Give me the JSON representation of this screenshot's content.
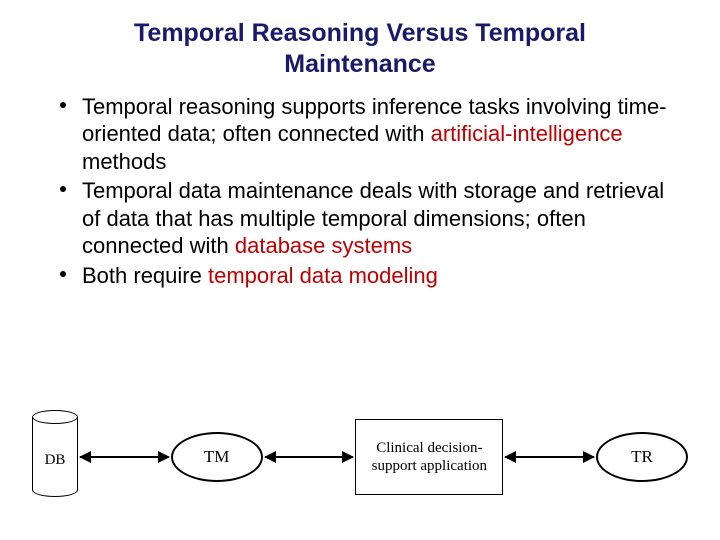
{
  "title": "Temporal Reasoning Versus Temporal Maintenance",
  "bullets": [
    {
      "pre": "Temporal reasoning supports inference tasks involving time-oriented data; often connected with ",
      "hl": "artificial-intelligence",
      "post": " methods"
    },
    {
      "pre": "Temporal data maintenance deals with storage and retrieval of data that has multiple temporal dimensions; often connected with ",
      "hl": "database systems",
      "post": ""
    },
    {
      "pre": "Both require ",
      "hl": "temporal data modeling",
      "post": ""
    }
  ],
  "diagram": {
    "db": "DB",
    "tm": "TM",
    "app": "Clinical decision-support application",
    "tr": "TR"
  }
}
